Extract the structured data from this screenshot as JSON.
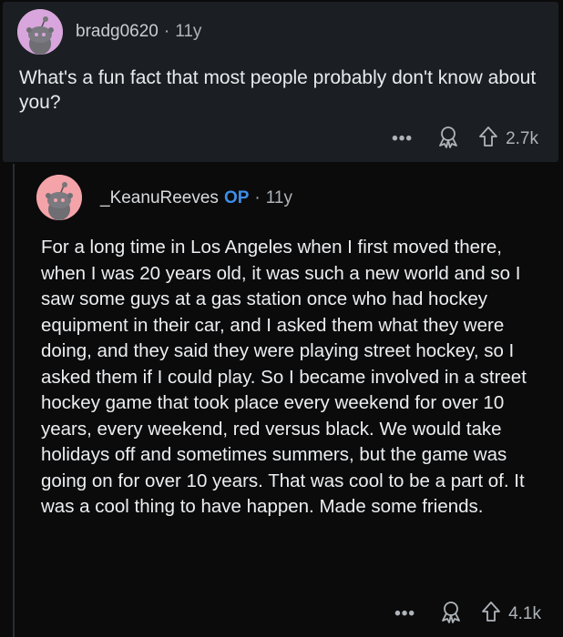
{
  "post": {
    "username": "bradg0620",
    "separator": "·",
    "age": "11y",
    "title": "What's a fun fact that most people probably don't know about you?",
    "more_label": "•••",
    "upvotes": "2.7k",
    "avatar_color": "#d8a6dd"
  },
  "comment": {
    "username": "_KeanuReeves",
    "op_badge": "OP",
    "separator": "·",
    "age": "11y",
    "body": "For a long time in Los Angeles when I first moved there,  when I was 20 years old,  it was such a new world and so I saw some guys at a gas station once who had hockey equipment in their car, and I asked them what they were doing, and they said they were playing street hockey, so I asked them if I could play.  So I became involved in a street hockey game that took place every weekend for over 10 years, every weekend, red versus black.  We would take holidays off and sometimes summers, but the game was going on for over 10 years.  That was cool to be a part of.  It was a cool thing to have happen.  Made some friends.",
    "more_label": "•••",
    "upvotes": "4.1k",
    "avatar_color": "#f4a3a9",
    "op_color": "#3d8ee8"
  },
  "icons": {
    "avatar": "snoo-avatar-icon",
    "award": "award-icon",
    "upvote": "upvote-arrow-icon",
    "more": "more-options-icon"
  }
}
